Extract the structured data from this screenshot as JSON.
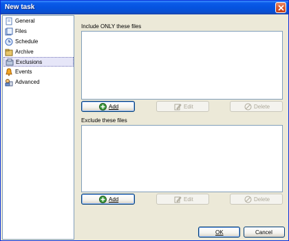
{
  "window": {
    "title": "New task"
  },
  "sidebar": {
    "items": [
      {
        "label": "General",
        "icon": "general-icon"
      },
      {
        "label": "Files",
        "icon": "files-icon"
      },
      {
        "label": "Schedule",
        "icon": "schedule-icon"
      },
      {
        "label": "Archive",
        "icon": "archive-icon"
      },
      {
        "label": "Exclusions",
        "icon": "exclusions-icon",
        "selected": true
      },
      {
        "label": "Events",
        "icon": "events-icon"
      },
      {
        "label": "Advanced",
        "icon": "advanced-icon"
      }
    ]
  },
  "include": {
    "label": "Include ONLY these files",
    "add_label": "Add",
    "edit_label": "Edit",
    "delete_label": "Delete"
  },
  "exclude": {
    "label": "Exclude these files",
    "add_label": "Add",
    "edit_label": "Edit",
    "delete_label": "Delete"
  },
  "footer": {
    "ok_label": "OK",
    "cancel_label": "Cancel"
  },
  "colors": {
    "title_bar": "#0553e0",
    "dialog_bg": "#ece9d8",
    "selected_item": "#e6e6f8"
  }
}
